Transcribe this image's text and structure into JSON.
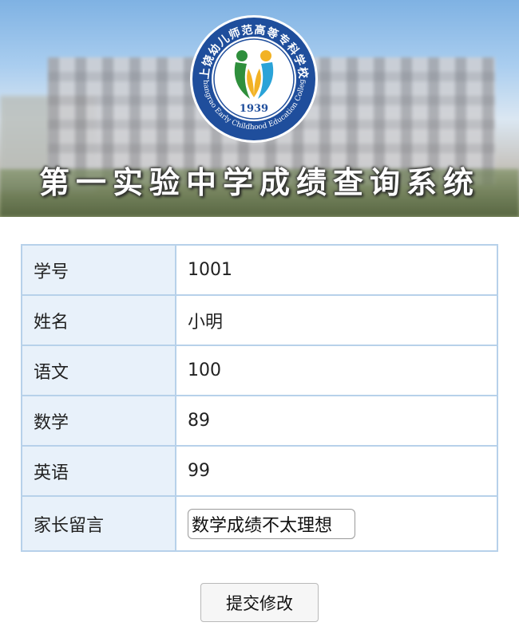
{
  "banner": {
    "title": "第一实验中学成绩查询系统",
    "logo": {
      "arc_top_text": "上饶幼儿师范高等专科学校",
      "arc_bottom_text": "Shangrao Early Childhood Education College",
      "year": "1939",
      "ring_color": "#1f4e9c",
      "leaf_colors": [
        "#2f8f3c",
        "#f2b224",
        "#2aa3d8"
      ]
    }
  },
  "table": {
    "rows": [
      {
        "label": "学号",
        "value": "1001"
      },
      {
        "label": "姓名",
        "value": "小明"
      },
      {
        "label": "语文",
        "value": "100"
      },
      {
        "label": "数学",
        "value": "89"
      },
      {
        "label": "英语",
        "value": "99"
      }
    ],
    "message": {
      "label": "家长留言",
      "value": "数学成绩不太理想"
    }
  },
  "submit": {
    "label": "提交修改"
  },
  "colors": {
    "border": "#b7d1ea",
    "label_bg": "#e8f1fa"
  }
}
